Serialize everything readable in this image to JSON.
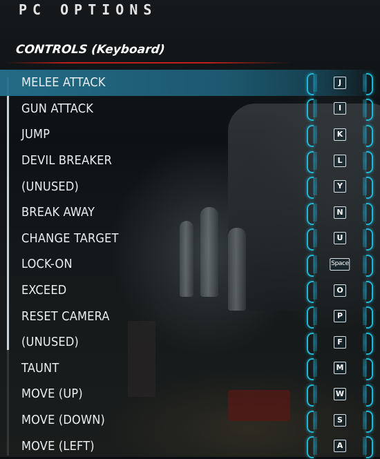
{
  "header": {
    "title": "PC OPTIONS",
    "section": "CONTROLS (Keyboard)"
  },
  "controls": [
    {
      "label": "MELEE ATTACK",
      "key": "J",
      "selected": true
    },
    {
      "label": "GUN ATTACK",
      "key": "I"
    },
    {
      "label": "JUMP",
      "key": "K"
    },
    {
      "label": "DEVIL BREAKER",
      "key": "L"
    },
    {
      "label": "(UNUSED)",
      "key": "Y"
    },
    {
      "label": "BREAK AWAY",
      "key": "N"
    },
    {
      "label": "CHANGE TARGET",
      "key": "U"
    },
    {
      "label": "LOCK-ON",
      "key": "Space"
    },
    {
      "label": "EXCEED",
      "key": "O"
    },
    {
      "label": "RESET CAMERA",
      "key": "P"
    },
    {
      "label": "(UNUSED)",
      "key": "F"
    },
    {
      "label": "TAUNT",
      "key": "M"
    },
    {
      "label": "MOVE (UP)",
      "key": "W"
    },
    {
      "label": "MOVE (DOWN)",
      "key": "S"
    },
    {
      "label": "MOVE (LEFT)",
      "key": "A"
    }
  ],
  "colors": {
    "accent": "#1fb7d6",
    "selected_row": "#24708c",
    "header_rule": "#c02019"
  }
}
